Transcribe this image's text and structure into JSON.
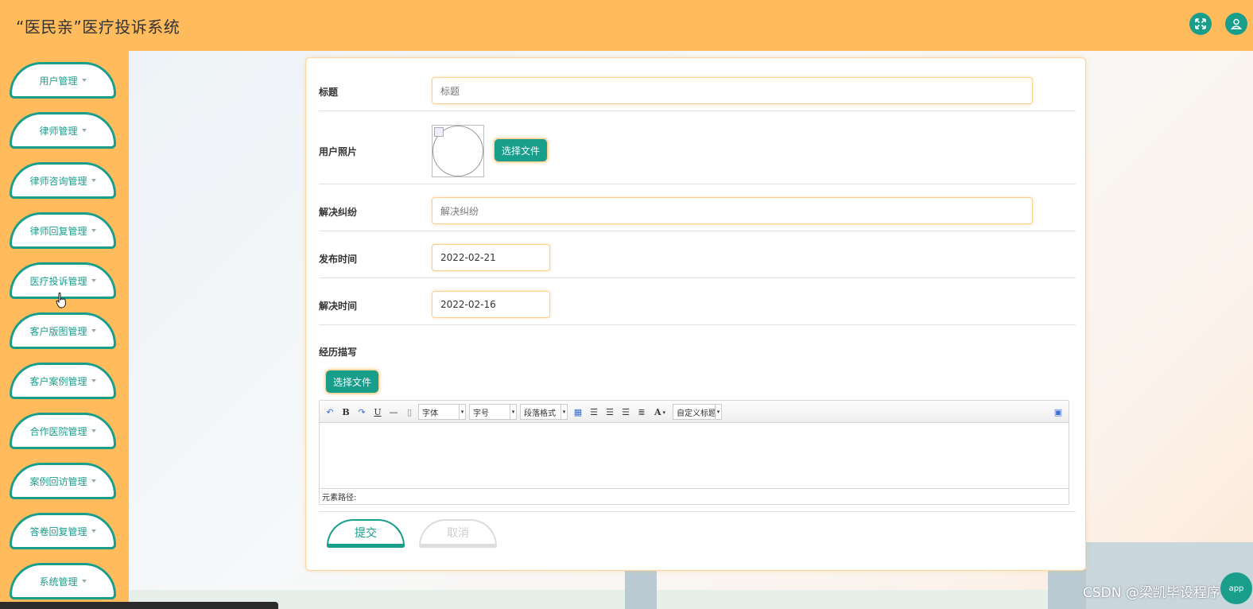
{
  "header": {
    "title": "“医民亲”医疗投诉系统",
    "fullscreen_icon": "expand-icon",
    "user_icon": "user-icon"
  },
  "sidebar": {
    "items": [
      {
        "label": "用户管理"
      },
      {
        "label": "律师管理"
      },
      {
        "label": "律师咨询管理"
      },
      {
        "label": "律师回复管理"
      },
      {
        "label": "医疗投诉管理"
      },
      {
        "label": "客户版图管理"
      },
      {
        "label": "客户案例管理"
      },
      {
        "label": "合作医院管理"
      },
      {
        "label": "案例回访管理"
      },
      {
        "label": "答卷回复管理"
      },
      {
        "label": "系统管理"
      }
    ]
  },
  "form": {
    "title_label": "标题",
    "title_placeholder": "标题",
    "photo_label": "用户照片",
    "photo_button": "选择文件",
    "dispute_label": "解决纠纷",
    "dispute_placeholder": "解决纠纷",
    "publish_label": "发布时间",
    "publish_value": "2022-02-21",
    "resolve_label": "解决时间",
    "resolve_value": "2022-02-16",
    "experience_label": "经历描写",
    "experience_button": "选择文件",
    "submit": "提交",
    "cancel": "取消"
  },
  "editor": {
    "font_family": "字体",
    "font_size": "字号",
    "paragraph": "段落格式",
    "custom_title": "自定义标题",
    "bold": "B",
    "underline": "U",
    "font_color": "A",
    "status": "元素路径:"
  },
  "watermark": "CSDN @梁凯毕设程序",
  "app_bubble": "app",
  "colors": {
    "accent": "#1a9e8c",
    "header": "#ffbb5c"
  }
}
